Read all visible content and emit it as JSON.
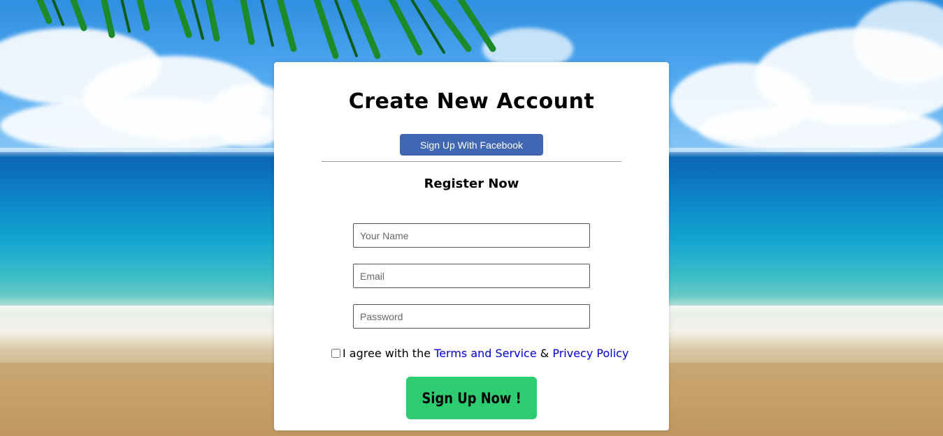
{
  "page": {
    "title": "Create New Account",
    "facebook_button": "Sign Up With Facebook",
    "subtitle": "Register Now"
  },
  "form": {
    "name_placeholder": "Your Name",
    "email_placeholder": "Email",
    "password_placeholder": "Password",
    "agree_prefix": "I agree with the ",
    "terms_link": "Terms and Service",
    "ampersand": " & ",
    "privacy_link": "Privecy Policy",
    "agree_checked": false,
    "submit_label": "Sign Up Now !"
  },
  "colors": {
    "facebook": "#4267b2",
    "submit": "#2ecc71",
    "link": "#0000cc",
    "card": "#ffffff"
  }
}
